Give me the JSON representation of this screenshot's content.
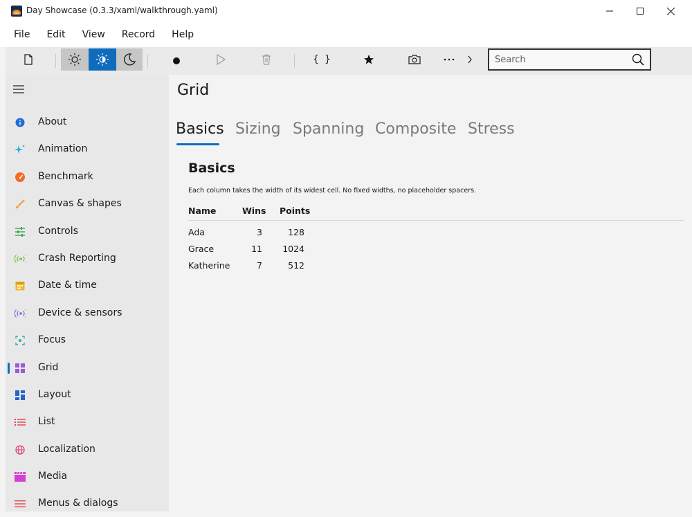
{
  "window": {
    "title": "Day Showcase (0.3.3/xaml/walkthrough.yaml)",
    "controls": [
      "minimize",
      "maximize",
      "close"
    ]
  },
  "menubar": {
    "items": [
      "File",
      "Edit",
      "View",
      "Record",
      "Help"
    ]
  },
  "toolbar": {
    "buttons": [
      "new-document-icon",
      "theme-light-icon",
      "theme-auto-icon",
      "theme-dark-icon",
      "record-icon",
      "play-icon",
      "trash-icon",
      "braces-icon",
      "star-icon",
      "camera-icon",
      "more-icon",
      "chevron-right-icon"
    ],
    "selected_theme": "auto",
    "search": {
      "placeholder": "Search",
      "value": ""
    },
    "accent_color": "#0f6cbd"
  },
  "sidebar": {
    "items": [
      {
        "label": "About",
        "icon": "info-icon",
        "color": "#1f6fd6"
      },
      {
        "label": "Animation",
        "icon": "sparkle-icon",
        "color": "#2aa7d8"
      },
      {
        "label": "Benchmark",
        "icon": "gauge-icon",
        "color": "#f36c21"
      },
      {
        "label": "Canvas & shapes",
        "icon": "brush-icon",
        "color": "#f39c33"
      },
      {
        "label": "Controls",
        "icon": "sliders-icon",
        "color": "#3aa64a"
      },
      {
        "label": "Crash Reporting",
        "icon": "broadcast-icon",
        "color": "#6abf3c"
      },
      {
        "label": "Date & time",
        "icon": "calendar-icon",
        "color": "#f2b630"
      },
      {
        "label": "Device & sensors",
        "icon": "sensor-icon",
        "color": "#6a6fd6"
      },
      {
        "label": "Focus",
        "icon": "focus-icon",
        "color": "#2fb0a0"
      },
      {
        "label": "Grid",
        "icon": "grid-icon",
        "color": "#9b5bd6"
      },
      {
        "label": "Layout",
        "icon": "layout-icon",
        "color": "#2563c9"
      },
      {
        "label": "List",
        "icon": "list-icon",
        "color": "#e2404a"
      },
      {
        "label": "Localization",
        "icon": "globe-icon",
        "color": "#e0457a"
      },
      {
        "label": "Media",
        "icon": "clapper-icon",
        "color": "#d43fd6"
      },
      {
        "label": "Menus & dialogs",
        "icon": "menu-icon",
        "color": "#e2404a"
      }
    ],
    "selected": "Grid"
  },
  "main": {
    "title": "Grid",
    "tabs": [
      "Basics",
      "Sizing",
      "Spanning",
      "Composite",
      "Stress"
    ],
    "active_tab": "Basics",
    "section": {
      "title": "Basics",
      "description": "Each column takes the width of its widest cell. No fixed widths, no placeholder spacers.",
      "columns": [
        "Name",
        "Wins",
        "Points"
      ],
      "rows": [
        [
          "Ada",
          "3",
          "128"
        ],
        [
          "Grace",
          "11",
          "1024"
        ],
        [
          "Katherine",
          "7",
          "512"
        ]
      ]
    }
  }
}
